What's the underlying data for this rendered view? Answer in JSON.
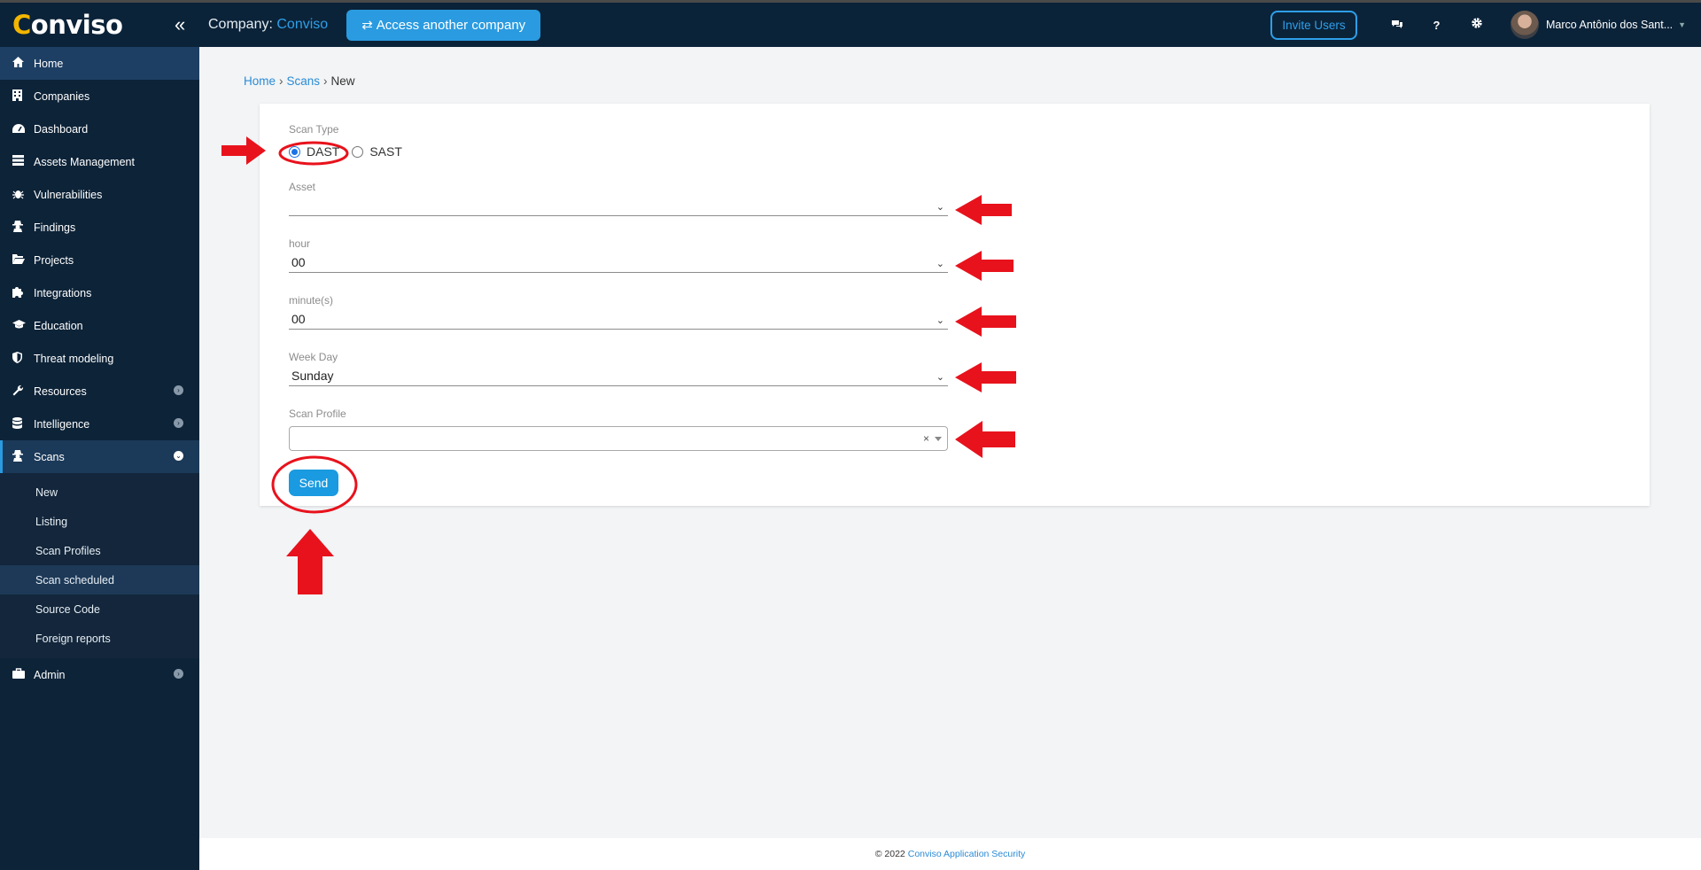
{
  "topbar": {
    "logo_text": "Conviso",
    "logo_first": "C",
    "logo_rest": "onviso",
    "company_prefix": "Company:",
    "company_name": "Conviso",
    "access_label": "Access another company",
    "invite_label": "Invite Users",
    "user_name": "Marco Antônio dos Sant...",
    "icons": [
      "collapse-icon",
      "swap-icon",
      "chat-icon",
      "help-icon",
      "settings-icon",
      "caret-icon"
    ]
  },
  "sidebar": {
    "items": [
      {
        "label": "Home",
        "icon": "home-icon"
      },
      {
        "label": "Companies",
        "icon": "building-icon"
      },
      {
        "label": "Dashboard",
        "icon": "gauge-icon"
      },
      {
        "label": "Assets Management",
        "icon": "server-icon"
      },
      {
        "label": "Vulnerabilities",
        "icon": "bug-icon"
      },
      {
        "label": "Findings",
        "icon": "user-secret-icon"
      },
      {
        "label": "Projects",
        "icon": "folder-icon"
      },
      {
        "label": "Integrations",
        "icon": "puzzle-icon"
      },
      {
        "label": "Education",
        "icon": "graduation-icon"
      },
      {
        "label": "Threat modeling",
        "icon": "shield-icon"
      },
      {
        "label": "Resources",
        "icon": "wrench-icon"
      },
      {
        "label": "Intelligence",
        "icon": "database-icon"
      },
      {
        "label": "Scans",
        "icon": "user-secret-icon"
      },
      {
        "label": "Admin",
        "icon": "briefcase-icon"
      }
    ],
    "scans_sub": [
      "New",
      "Listing",
      "Scan Profiles",
      "Scan scheduled",
      "Source Code",
      "Foreign reports"
    ]
  },
  "breadcrumb": {
    "home": "Home",
    "scans": "Scans",
    "current": "New",
    "sep": "›"
  },
  "form": {
    "scan_type_label": "Scan Type",
    "option_dast": "DAST",
    "option_sast": "SAST",
    "selected_type": "DAST",
    "asset_label": "Asset",
    "asset_value": "",
    "hour_label": "hour",
    "hour_value": "00",
    "minute_label": "minute(s)",
    "minute_value": "00",
    "weekday_label": "Week Day",
    "weekday_value": "Sunday",
    "profile_label": "Scan Profile",
    "profile_value": "",
    "profile_clear": "×",
    "send_label": "Send"
  },
  "footer": {
    "copyright": "© 2022",
    "link": "Conviso Application Security"
  },
  "colors": {
    "navy": "#0b2339",
    "accent": "#2a9be0",
    "annotation_red": "#e8121c"
  }
}
